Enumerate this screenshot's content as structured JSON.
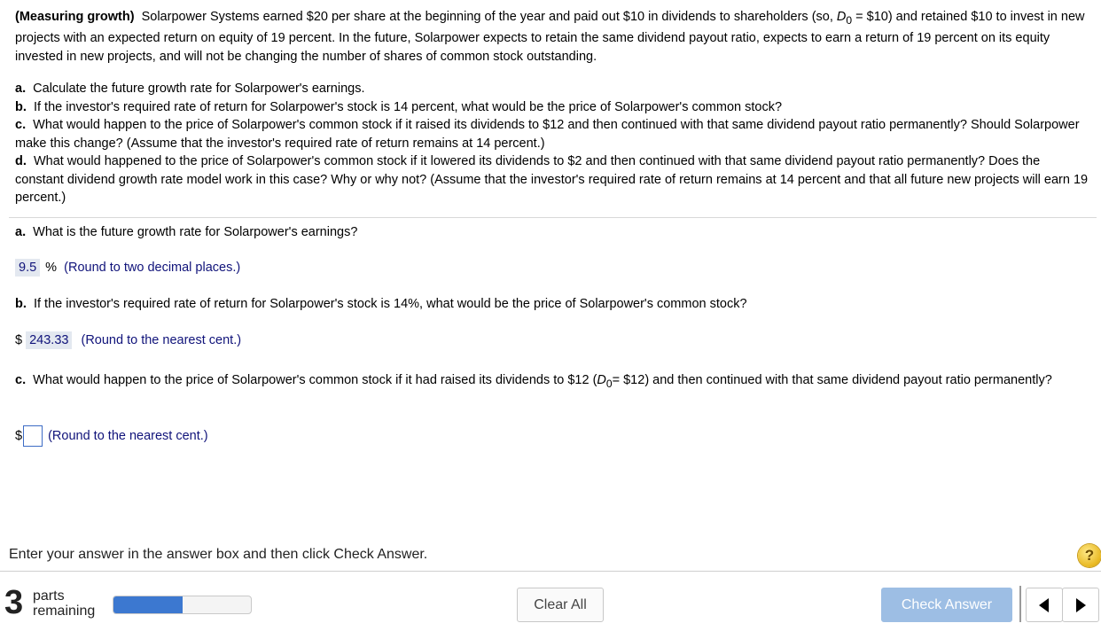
{
  "problem": {
    "title": "(Measuring growth)",
    "intro_pre": "Solarpower Systems earned $20 per share at the beginning of the year and paid out $10 in dividends to shareholders (so, ",
    "d_var": "D",
    "d_sub": "0",
    "intro_post": " = $10) and retained $10 to invest in new projects with an expected return on equity of 19 percent.  In the future, Solarpower expects to retain the same dividend payout ratio, expects to earn a return of 19 percent on its equity invested in new projects, and will not be changing the number of shares of common stock outstanding.",
    "parts": [
      {
        "letter": "a.",
        "text": "Calculate the future growth rate for Solarpower's earnings."
      },
      {
        "letter": "b.",
        "text": "If the investor's required rate of return for Solarpower's stock is 14 percent, what would be the price of Solarpower's common stock?"
      },
      {
        "letter": "c.",
        "text": "What would happen to the price of Solarpower's common stock if it raised its dividends to $12 and then continued with that same dividend payout ratio permanently?  Should Solarpower make this change?  (Assume that the investor's required rate of return remains at 14 percent.)"
      },
      {
        "letter": "d.",
        "text": "What would happened to the price of Solarpower's common stock if it lowered its dividends to $2 and then continued with that same dividend payout ratio permanently?  Does the constant dividend growth rate model work in this case?  Why or why not?  (Assume that the investor's required rate of return remains at 14 percent and that all future new projects will earn 19 percent.)"
      }
    ]
  },
  "qa": {
    "a": {
      "letter": "a.",
      "question": "What is the future growth rate for Solarpower's earnings?",
      "answer": "9.5",
      "unit": "%",
      "instruction": "(Round to two decimal places.)"
    },
    "b": {
      "letter": "b.",
      "question": "If the investor's required rate of return for Solarpower's stock is 14%, what would be the price of Solarpower's common stock?",
      "currency": "$",
      "answer": "243.33",
      "instruction": "(Round to the nearest cent.)"
    },
    "c": {
      "letter": "c.",
      "question_pre": "What would happen to the price of Solarpower's common stock if it had raised its dividends to $12 (",
      "d_var": "D",
      "d_sub": "0",
      "question_post": "= $12) and then continued with that same dividend payout ratio permanently?",
      "currency": "$",
      "answer": "",
      "instruction": "(Round to the nearest cent.)"
    }
  },
  "footer": {
    "message": "Enter your answer in the answer box and then click Check Answer.",
    "help": "?",
    "parts_count": "3",
    "parts_label_1": "parts",
    "parts_label_2": "remaining",
    "progress_fraction": 0.5,
    "clear_label": "Clear All",
    "check_label": "Check Answer"
  },
  "icons": {
    "help": "help-icon",
    "prev": "triangle-left-icon",
    "next": "triangle-right-icon"
  },
  "colors": {
    "accent": "#3c78d0",
    "instruction_text": "#10137a",
    "answer_bg": "#e3e8f0",
    "check_button": "#9dbee4"
  }
}
